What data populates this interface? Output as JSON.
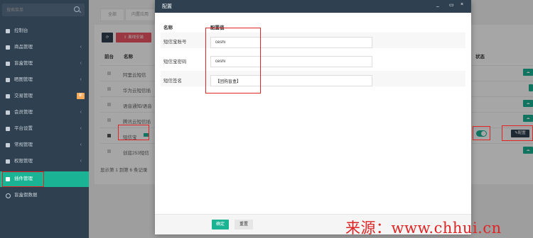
{
  "sidebar": {
    "search_placeholder": "搜索菜单",
    "items": [
      {
        "label": "控制台",
        "chev": ""
      },
      {
        "label": "商品管理",
        "chev": "‹"
      },
      {
        "label": "盲盒管理",
        "chev": "‹"
      },
      {
        "label": "晒图管理",
        "chev": "‹"
      },
      {
        "label": "交易管理",
        "chev": "",
        "badge": "新"
      },
      {
        "label": "会员管理",
        "chev": "‹"
      },
      {
        "label": "平台设置",
        "chev": "‹"
      },
      {
        "label": "常规管理",
        "chev": "‹"
      },
      {
        "label": "权限管理",
        "chev": "‹"
      },
      {
        "label": "插件管理",
        "chev": ""
      },
      {
        "label": "盲盒假数据",
        "chev": ""
      }
    ]
  },
  "tabs": [
    "全部",
    "内置应用"
  ],
  "toolbar": {
    "refresh_icon": "refresh-icon",
    "install_label": "离线安装"
  },
  "table": {
    "headers": {
      "frontend": "前台",
      "name": "名称",
      "status": "状态"
    },
    "rows": [
      {
        "name": "阿里云短信"
      },
      {
        "name": "华为云短信插"
      },
      {
        "name": "语音通知/语音"
      },
      {
        "name": "腾讯云短信插"
      },
      {
        "name": "短信宝"
      },
      {
        "name": "创蓝253短信"
      }
    ],
    "footer": "显示第 1 到第 6 条记录",
    "config_label": "配置"
  },
  "modal": {
    "title": "配置",
    "col_name": "名称",
    "col_value": "配置值",
    "fields": [
      {
        "label": "短信宝账号",
        "value": "ceshi"
      },
      {
        "label": "短信宝密码",
        "value": "ceshi"
      },
      {
        "label": "短信签名",
        "value": "【团购盲盒】"
      }
    ],
    "ok_label": "确定",
    "reset_label": "重置"
  },
  "watermark": "来源：www.chhui.cn",
  "colors": {
    "sidebar": "#2f4050",
    "accent": "#1ab394",
    "danger": "#ed5565",
    "annotation": "#e02424"
  }
}
